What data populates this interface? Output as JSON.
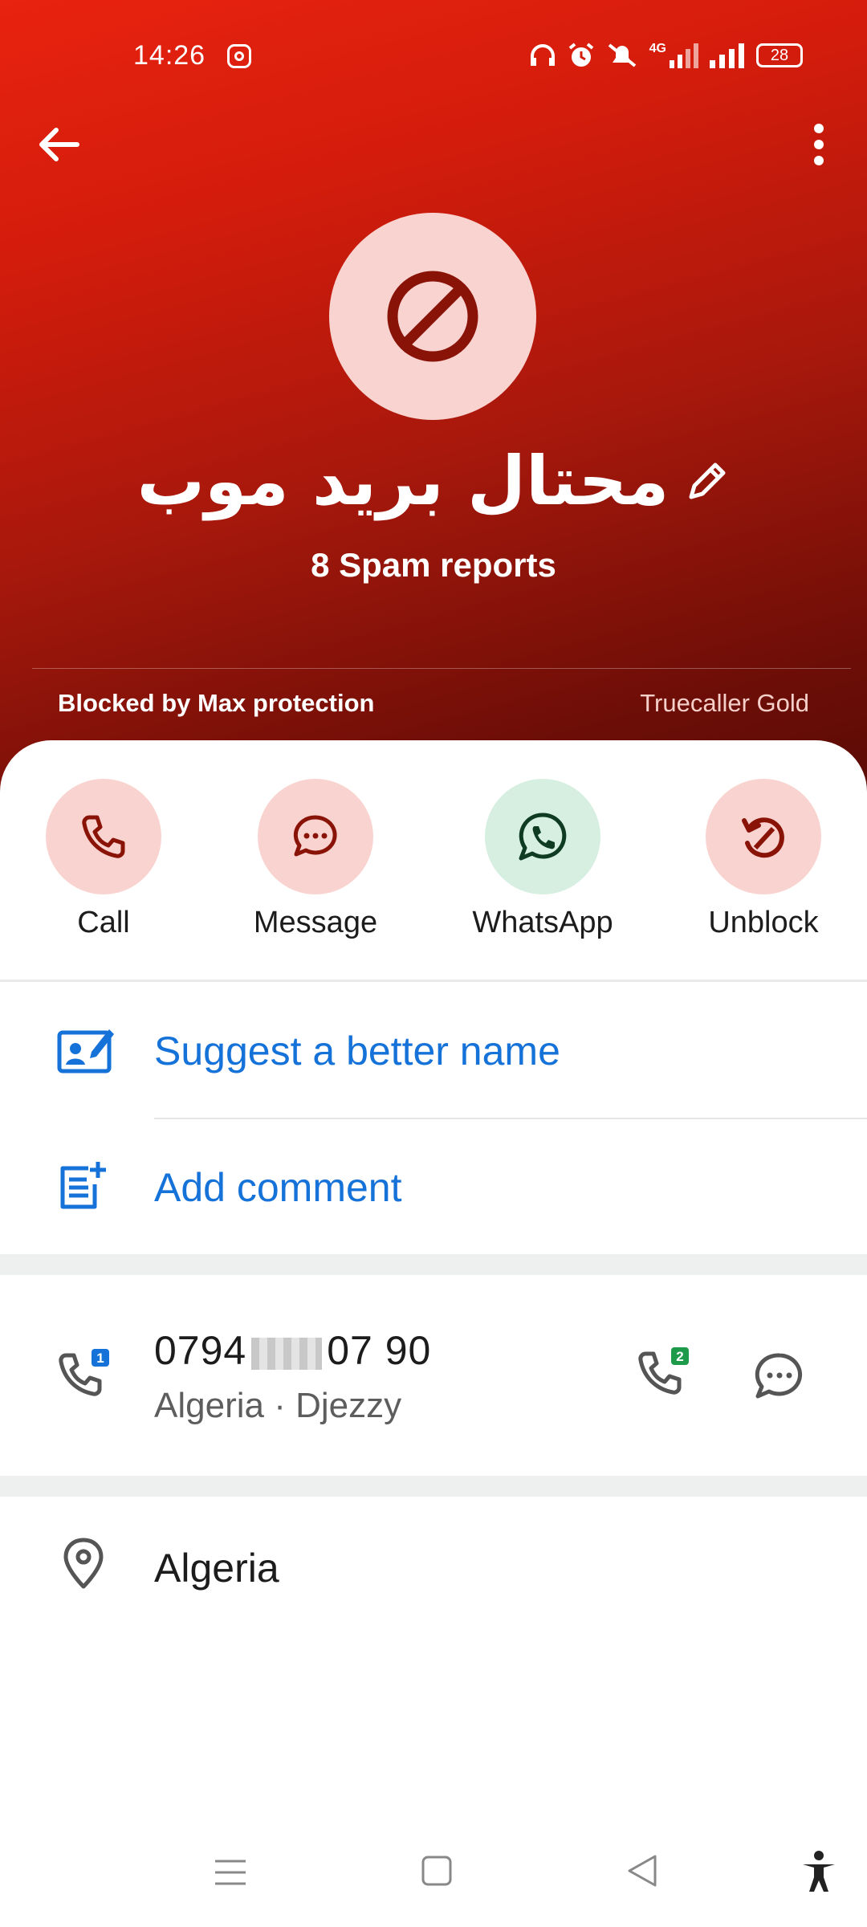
{
  "status_bar": {
    "time": "14:26",
    "signal_label": "4G",
    "battery": "28"
  },
  "header": {
    "contact_name": "محتال بريد موب",
    "spam_reports": "8 Spam reports",
    "blocked_text": "Blocked by Max protection",
    "badge_text": "Truecaller Gold"
  },
  "actions": [
    {
      "label": "Call",
      "icon": "phone-icon",
      "color": "#f9d3cf"
    },
    {
      "label": "Message",
      "icon": "message-icon",
      "color": "#f9d3cf"
    },
    {
      "label": "WhatsApp",
      "icon": "whatsapp-icon",
      "color": "#d6efe1"
    },
    {
      "label": "Unblock",
      "icon": "unblock-icon",
      "color": "#f9d3cf"
    }
  ],
  "suggestions": {
    "suggest_name": "Suggest a better name",
    "add_comment": "Add comment"
  },
  "number": {
    "prefix": "0794",
    "suffix": "07 90",
    "carrier": "Algeria · Djezzy",
    "sim1_badge": "1",
    "sim2_badge": "2"
  },
  "location": {
    "country": "Algeria"
  },
  "colors": {
    "accent_blue": "#1572d8",
    "header_red": "#e8230f",
    "dark_red": "#7a0e06"
  }
}
